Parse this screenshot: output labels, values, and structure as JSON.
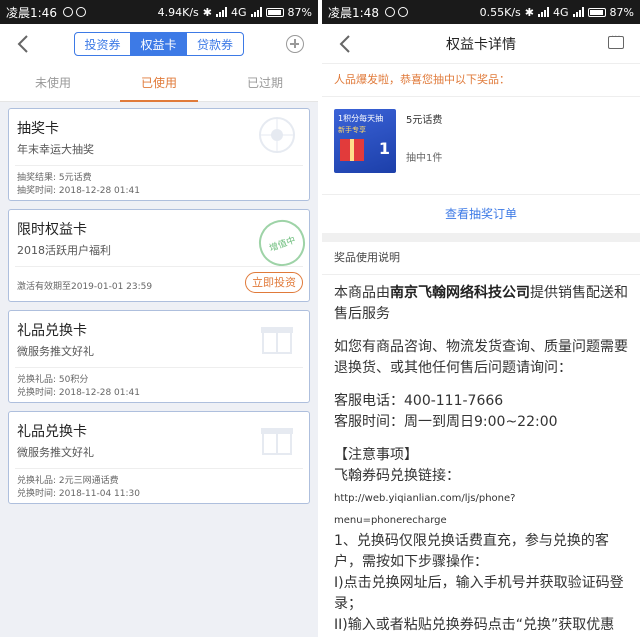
{
  "left": {
    "status": {
      "time": "凌晨1:46",
      "speed": "4.94K/s",
      "network": "4G",
      "battery": "87%"
    },
    "nav": {
      "segments": [
        "投资券",
        "权益卡",
        "贷款券"
      ],
      "active": 1
    },
    "tabs": [
      "未使用",
      "已使用",
      "已过期"
    ],
    "cards": [
      {
        "title": "抽奖卡",
        "subtitle": "年末幸运大抽奖",
        "line1": "抽奖结果: 5元话费",
        "line2": "抽奖时间: 2018-12-28 01:41"
      },
      {
        "title": "限时权益卡",
        "subtitle": "2018活跃用户福利",
        "line1": "激活有效期至2019-01-01 23:59",
        "button": "立即投资",
        "stamp": "增值中"
      },
      {
        "title": "礼品兑换卡",
        "subtitle": "微服务推文好礼",
        "line1": "兑换礼品: 50积分",
        "line2": "兑换时间: 2018-12-28 01:41"
      },
      {
        "title": "礼品兑换卡",
        "subtitle": "微服务推文好礼",
        "line1": "兑换礼品: 2元三网通话费",
        "line2": "兑换时间: 2018-11-04 11:30"
      }
    ]
  },
  "right": {
    "status": {
      "time": "凌晨1:48",
      "speed": "0.55K/s",
      "network": "4G",
      "battery": "87%"
    },
    "title": "权益卡详情",
    "congrats": "人品爆发啦，恭喜您抽中以下奖品：",
    "prize": {
      "img_line1": "1积分每天抽",
      "img_line2": "新手专享",
      "img_num": "1",
      "name": "5元话费",
      "count": "抽中1件"
    },
    "order_link": "查看抽奖订单",
    "instructions_title": "奖品使用说明",
    "p1_pre": "本商品由",
    "p1_company": "南京飞翰网络科技公司",
    "p1_post": "提供销售配送和售后服务",
    "p2": "如您有商品咨询、物流发货查询、质量问题需要退换货、或其他任何售后问题请询问：",
    "phone": "客服电话：400-111-7666",
    "hours": "客服时间：周一到周日9:00~22:00",
    "notice_header": "【注意事项】",
    "link_label": "飞翰券码兑换链接：",
    "link_url": "http://web.yiqianlian.com/ljs/phone?menu=phonerecharge",
    "step1": "1、兑换码仅限兑换话费直充，参与兑换的客户，需按如下步骤操作：",
    "step_i": "I)点击兑换网址后，输入手机号并获取验证码登录；",
    "step_ii": "II)输入或者粘贴兑换券码点击“兑换”获取优惠券；"
  }
}
